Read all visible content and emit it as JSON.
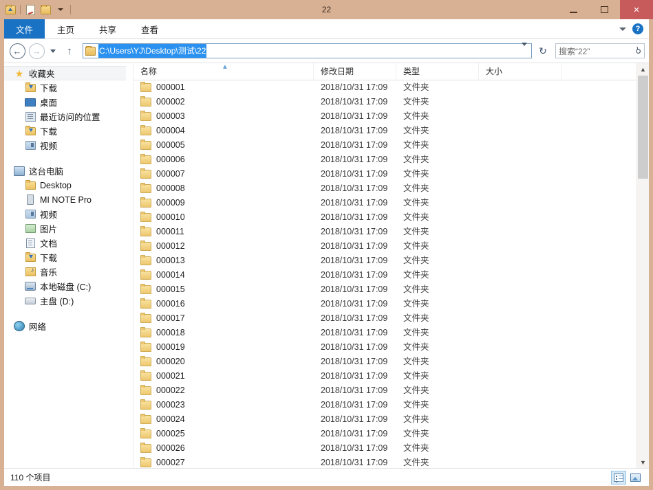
{
  "window": {
    "title": "22",
    "controls": {
      "minimize": "minimize",
      "maximize": "maximize",
      "close": "×"
    }
  },
  "quick_access": {
    "items": [
      "folder-up-icon",
      "new-folder-icon",
      "properties-icon"
    ],
    "dropdown": "customize-quick-access"
  },
  "ribbon": {
    "tabs": [
      {
        "label": "文件",
        "active": true
      },
      {
        "label": "主页",
        "active": false
      },
      {
        "label": "共享",
        "active": false
      },
      {
        "label": "查看",
        "active": false
      }
    ],
    "expand_label": "chevron-down",
    "help_label": "?"
  },
  "navbar": {
    "back": "←",
    "forward": "→",
    "history": "recent-locations",
    "up": "↑",
    "address_value": "C:\\Users\\YJ\\Desktop\\测试\\22",
    "refresh": "↻"
  },
  "search": {
    "placeholder": "搜索“22”",
    "icon": "search-icon"
  },
  "sidebar": {
    "groups": [
      {
        "root": {
          "label": "收藏夹",
          "icon": "star-icon",
          "highlight": true
        },
        "children": [
          {
            "label": "下载",
            "icon": "download-folder-icon"
          },
          {
            "label": "桌面",
            "icon": "desktop-icon"
          },
          {
            "label": "最近访问的位置",
            "icon": "recent-places-icon"
          },
          {
            "label": "下载",
            "icon": "download-folder-icon"
          },
          {
            "label": "视频",
            "icon": "videos-icon"
          }
        ]
      },
      {
        "root": {
          "label": "这台电脑",
          "icon": "this-pc-icon",
          "highlight": false
        },
        "children": [
          {
            "label": "Desktop",
            "icon": "desktop-folder-icon"
          },
          {
            "label": "MI NOTE Pro",
            "icon": "phone-icon"
          },
          {
            "label": "视频",
            "icon": "videos-icon"
          },
          {
            "label": "图片",
            "icon": "pictures-icon"
          },
          {
            "label": "文档",
            "icon": "documents-icon"
          },
          {
            "label": "下载",
            "icon": "download-folder-icon"
          },
          {
            "label": "音乐",
            "icon": "music-icon"
          },
          {
            "label": "本地磁盘 (C:)",
            "icon": "hard-drive-icon"
          },
          {
            "label": "主盘 (D:)",
            "icon": "drive-icon"
          }
        ]
      },
      {
        "root": {
          "label": "网络",
          "icon": "network-icon",
          "highlight": false
        },
        "children": []
      }
    ]
  },
  "filelist": {
    "columns": [
      {
        "key": "name",
        "label": "名称",
        "sorted": "asc"
      },
      {
        "key": "date",
        "label": "修改日期"
      },
      {
        "key": "type",
        "label": "类型"
      },
      {
        "key": "size",
        "label": "大小"
      }
    ],
    "rows": [
      {
        "name": "000001",
        "date": "2018/10/31 17:09",
        "type": "文件夹",
        "size": ""
      },
      {
        "name": "000002",
        "date": "2018/10/31 17:09",
        "type": "文件夹",
        "size": ""
      },
      {
        "name": "000003",
        "date": "2018/10/31 17:09",
        "type": "文件夹",
        "size": ""
      },
      {
        "name": "000004",
        "date": "2018/10/31 17:09",
        "type": "文件夹",
        "size": ""
      },
      {
        "name": "000005",
        "date": "2018/10/31 17:09",
        "type": "文件夹",
        "size": ""
      },
      {
        "name": "000006",
        "date": "2018/10/31 17:09",
        "type": "文件夹",
        "size": ""
      },
      {
        "name": "000007",
        "date": "2018/10/31 17:09",
        "type": "文件夹",
        "size": ""
      },
      {
        "name": "000008",
        "date": "2018/10/31 17:09",
        "type": "文件夹",
        "size": ""
      },
      {
        "name": "000009",
        "date": "2018/10/31 17:09",
        "type": "文件夹",
        "size": ""
      },
      {
        "name": "000010",
        "date": "2018/10/31 17:09",
        "type": "文件夹",
        "size": ""
      },
      {
        "name": "000011",
        "date": "2018/10/31 17:09",
        "type": "文件夹",
        "size": ""
      },
      {
        "name": "000012",
        "date": "2018/10/31 17:09",
        "type": "文件夹",
        "size": ""
      },
      {
        "name": "000013",
        "date": "2018/10/31 17:09",
        "type": "文件夹",
        "size": ""
      },
      {
        "name": "000014",
        "date": "2018/10/31 17:09",
        "type": "文件夹",
        "size": ""
      },
      {
        "name": "000015",
        "date": "2018/10/31 17:09",
        "type": "文件夹",
        "size": ""
      },
      {
        "name": "000016",
        "date": "2018/10/31 17:09",
        "type": "文件夹",
        "size": ""
      },
      {
        "name": "000017",
        "date": "2018/10/31 17:09",
        "type": "文件夹",
        "size": ""
      },
      {
        "name": "000018",
        "date": "2018/10/31 17:09",
        "type": "文件夹",
        "size": ""
      },
      {
        "name": "000019",
        "date": "2018/10/31 17:09",
        "type": "文件夹",
        "size": ""
      },
      {
        "name": "000020",
        "date": "2018/10/31 17:09",
        "type": "文件夹",
        "size": ""
      },
      {
        "name": "000021",
        "date": "2018/10/31 17:09",
        "type": "文件夹",
        "size": ""
      },
      {
        "name": "000022",
        "date": "2018/10/31 17:09",
        "type": "文件夹",
        "size": ""
      },
      {
        "name": "000023",
        "date": "2018/10/31 17:09",
        "type": "文件夹",
        "size": ""
      },
      {
        "name": "000024",
        "date": "2018/10/31 17:09",
        "type": "文件夹",
        "size": ""
      },
      {
        "name": "000025",
        "date": "2018/10/31 17:09",
        "type": "文件夹",
        "size": ""
      },
      {
        "name": "000026",
        "date": "2018/10/31 17:09",
        "type": "文件夹",
        "size": ""
      },
      {
        "name": "000027",
        "date": "2018/10/31 17:09",
        "type": "文件夹",
        "size": ""
      }
    ]
  },
  "statusbar": {
    "item_count": "110 个项目",
    "views": [
      {
        "name": "details-view",
        "active": true
      },
      {
        "name": "large-icons-view",
        "active": false
      }
    ]
  },
  "colors": {
    "titlebar": "#d8b094",
    "accent": "#1a72c4",
    "selection": "#2a91f0",
    "close_button": "#c75b5b"
  }
}
